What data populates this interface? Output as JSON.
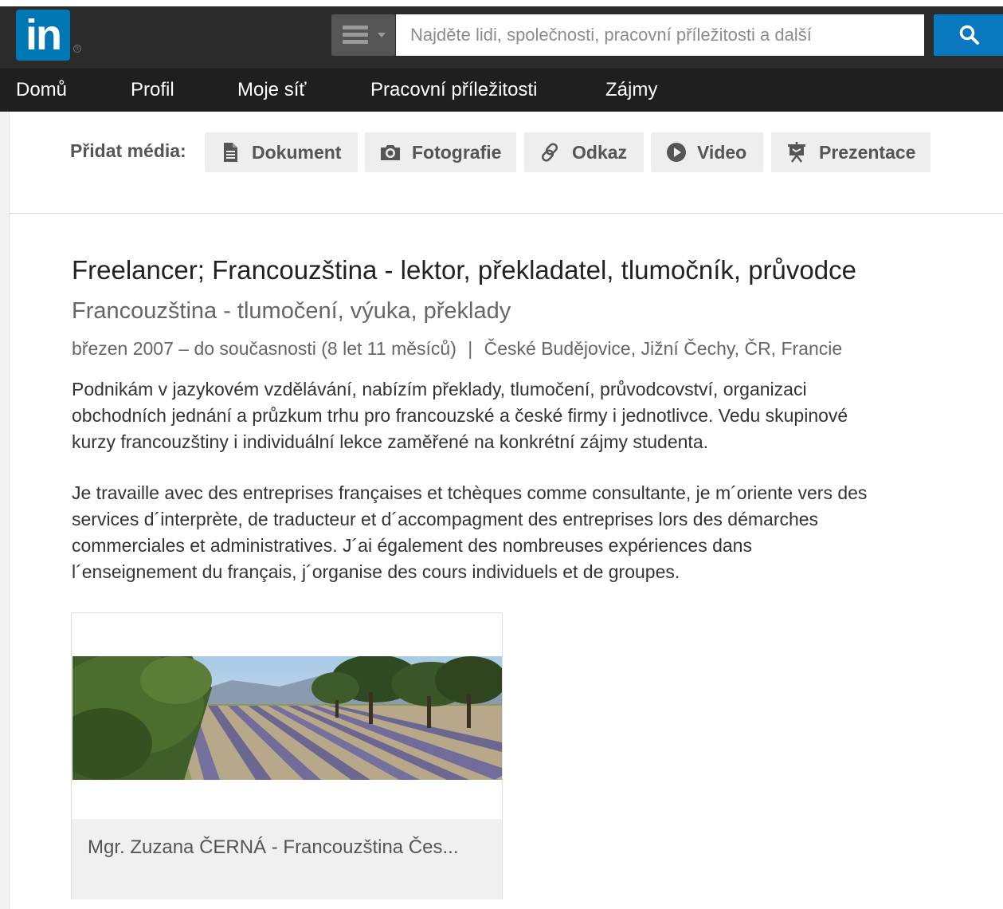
{
  "header": {
    "logo_text": "in",
    "logo_registered": "®",
    "brand_color": "#0077b5",
    "search": {
      "placeholder": "Najděte lidi, společnosti, pracovní příležitosti a další"
    }
  },
  "nav": {
    "items": [
      {
        "label": "Domů"
      },
      {
        "label": "Profil"
      },
      {
        "label": "Moje síť"
      },
      {
        "label": "Pracovní příležitosti"
      },
      {
        "label": "Zájmy"
      }
    ]
  },
  "media": {
    "label": "Přidat média:",
    "buttons": [
      {
        "label": "Dokument",
        "icon": "document-icon"
      },
      {
        "label": "Fotografie",
        "icon": "camera-icon"
      },
      {
        "label": "Odkaz",
        "icon": "link-icon"
      },
      {
        "label": "Video",
        "icon": "play-icon"
      },
      {
        "label": "Prezentace",
        "icon": "presentation-icon"
      }
    ]
  },
  "position": {
    "title": "Freelancer; Francouzština - lektor, překladatel, tlumočník, průvodce",
    "company": "Francouzština - tlumočení, výuka, překlady",
    "dates": "březen 2007 – do současnosti (8 let 11 měsíců)",
    "separator": "|",
    "location": "České Budějovice, Jižní Čechy, ČR, Francie",
    "description_cz": [
      "Podnikám v jazykovém vzdělávání, nabízím překlady, tlumočení, průvodcovství, organizaci",
      "obchodních jednání a průzkum trhu pro francouzské a české firmy i jednotlivce. Vedu skupinové",
      "kurzy francouzštiny i individuální lekce zaměřené na konkrétní zájmy studenta."
    ],
    "description_fr": [
      "Je travaille avec des entreprises françaises et tchèques comme consultante, je m´oriente vers des",
      "services d´interprète, de traducteur et d´accompagment des entreprises lors des démarches",
      "commerciales et administratives. J´ai également des nombreuses expériences dans",
      "l´enseignement du français, j´organise des cours individuels et de groupes."
    ],
    "media_card": {
      "caption": "Mgr. Zuzana ČERNÁ - Francouzština Čes..."
    }
  }
}
